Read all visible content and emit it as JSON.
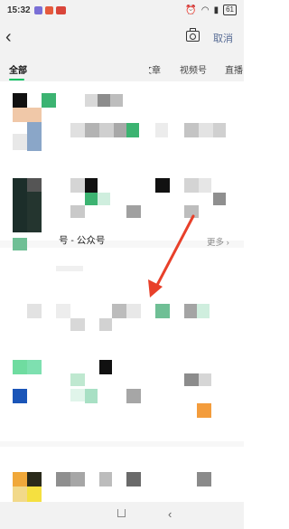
{
  "status_bar": {
    "time": "15:32",
    "battery": "61",
    "icons": [
      "alarm-icon",
      "wifi-icon",
      "signal-icon"
    ]
  },
  "header": {
    "back_icon": "chevron-left-icon",
    "camera_icon": "camera-icon",
    "cancel_label": "取消"
  },
  "tabs": {
    "items": [
      {
        "label": "全部",
        "active": true
      },
      {
        "label": "文章",
        "active": false
      },
      {
        "label": "视频号",
        "active": false
      },
      {
        "label": "直播",
        "active": false
      }
    ],
    "accent_color": "#07c160"
  },
  "results": {
    "section_title": "号 - 公众号",
    "more_label": "更多 ›"
  },
  "annotation": {
    "arrow_color": "#e8402a"
  }
}
